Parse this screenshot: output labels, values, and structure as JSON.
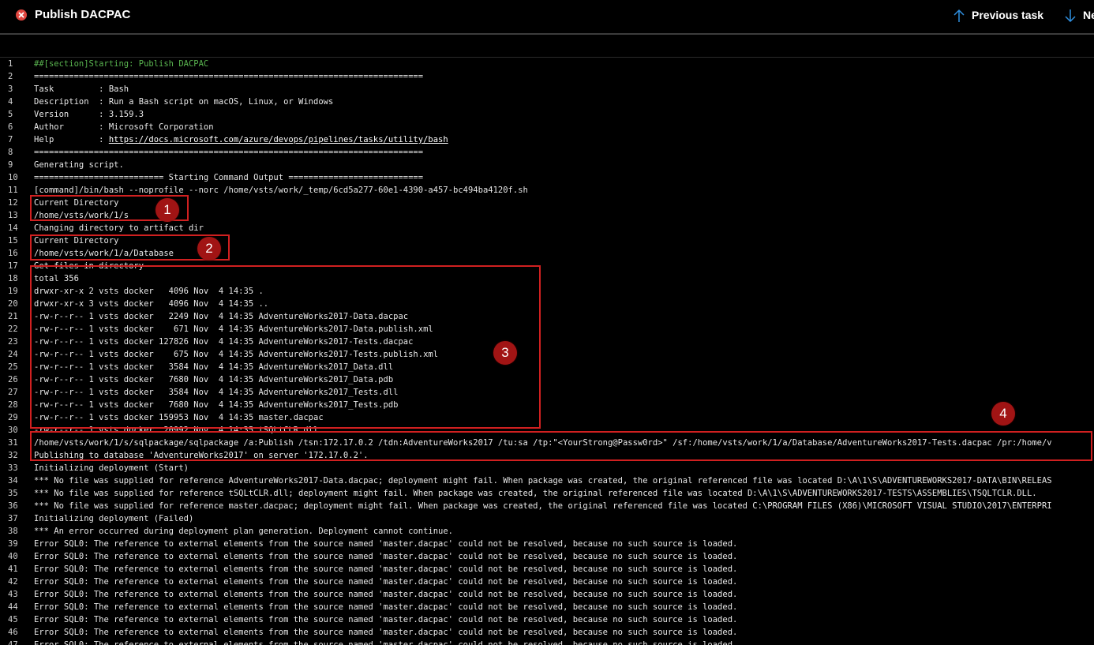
{
  "header": {
    "title": "Publish DACPAC",
    "previous_label": "Previous task",
    "next_label": "Ne"
  },
  "log_lines": [
    {
      "n": "1",
      "t": "##[section]Starting: Publish DACPAC"
    },
    {
      "n": "2",
      "t": "=============================================================================="
    },
    {
      "n": "3",
      "t": "Task         : Bash"
    },
    {
      "n": "4",
      "t": "Description  : Run a Bash script on macOS, Linux, or Windows"
    },
    {
      "n": "5",
      "t": "Version      : 3.159.3"
    },
    {
      "n": "6",
      "t": "Author       : Microsoft Corporation"
    },
    {
      "n": "7",
      "t": "Help         : https://docs.microsoft.com/azure/devops/pipelines/tasks/utility/bash"
    },
    {
      "n": "8",
      "t": "=============================================================================="
    },
    {
      "n": "9",
      "t": "Generating script."
    },
    {
      "n": "10",
      "t": "========================== Starting Command Output ==========================="
    },
    {
      "n": "11",
      "t": "[command]/bin/bash --noprofile --norc /home/vsts/work/_temp/6cd5a277-60e1-4390-a457-bc494ba4120f.sh"
    },
    {
      "n": "12",
      "t": "Current Directory"
    },
    {
      "n": "13",
      "t": "/home/vsts/work/1/s"
    },
    {
      "n": "14",
      "t": "Changing directory to artifact dir"
    },
    {
      "n": "15",
      "t": "Current Directory"
    },
    {
      "n": "16",
      "t": "/home/vsts/work/1/a/Database"
    },
    {
      "n": "17",
      "t": "Get files in directory"
    },
    {
      "n": "18",
      "t": "total 356"
    },
    {
      "n": "19",
      "t": "drwxr-xr-x 2 vsts docker   4096 Nov  4 14:35 ."
    },
    {
      "n": "20",
      "t": "drwxr-xr-x 3 vsts docker   4096 Nov  4 14:35 .."
    },
    {
      "n": "21",
      "t": "-rw-r--r-- 1 vsts docker   2249 Nov  4 14:35 AdventureWorks2017-Data.dacpac"
    },
    {
      "n": "22",
      "t": "-rw-r--r-- 1 vsts docker    671 Nov  4 14:35 AdventureWorks2017-Data.publish.xml"
    },
    {
      "n": "23",
      "t": "-rw-r--r-- 1 vsts docker 127826 Nov  4 14:35 AdventureWorks2017-Tests.dacpac"
    },
    {
      "n": "24",
      "t": "-rw-r--r-- 1 vsts docker    675 Nov  4 14:35 AdventureWorks2017-Tests.publish.xml"
    },
    {
      "n": "25",
      "t": "-rw-r--r-- 1 vsts docker   3584 Nov  4 14:35 AdventureWorks2017_Data.dll"
    },
    {
      "n": "26",
      "t": "-rw-r--r-- 1 vsts docker   7680 Nov  4 14:35 AdventureWorks2017_Data.pdb"
    },
    {
      "n": "27",
      "t": "-rw-r--r-- 1 vsts docker   3584 Nov  4 14:35 AdventureWorks2017_Tests.dll"
    },
    {
      "n": "28",
      "t": "-rw-r--r-- 1 vsts docker   7680 Nov  4 14:35 AdventureWorks2017_Tests.pdb"
    },
    {
      "n": "29",
      "t": "-rw-r--r-- 1 vsts docker 159953 Nov  4 14:35 master.dacpac"
    },
    {
      "n": "30",
      "t": "-rw-r--r-- 1 vsts docker  20992 Nov  4 14:35 tSQLtCLR.dll"
    },
    {
      "n": "31",
      "t": "/home/vsts/work/1/s/sqlpackage/sqlpackage /a:Publish /tsn:172.17.0.2 /tdn:AdventureWorks2017 /tu:sa /tp:\"<YourStrong@Passw0rd>\" /sf:/home/vsts/work/1/a/Database/AdventureWorks2017-Tests.dacpac /pr:/home/v"
    },
    {
      "n": "32",
      "t": "Publishing to database 'AdventureWorks2017' on server '172.17.0.2'."
    },
    {
      "n": "33",
      "t": "Initializing deployment (Start)"
    },
    {
      "n": "34",
      "t": "*** No file was supplied for reference AdventureWorks2017-Data.dacpac; deployment might fail. When package was created, the original referenced file was located D:\\A\\1\\S\\ADVENTUREWORKS2017-DATA\\BIN\\RELEAS"
    },
    {
      "n": "35",
      "t": "*** No file was supplied for reference tSQLtCLR.dll; deployment might fail. When package was created, the original referenced file was located D:\\A\\1\\S\\ADVENTUREWORKS2017-TESTS\\ASSEMBLIES\\TSQLTCLR.DLL."
    },
    {
      "n": "36",
      "t": "*** No file was supplied for reference master.dacpac; deployment might fail. When package was created, the original referenced file was located C:\\PROGRAM FILES (X86)\\MICROSOFT VISUAL STUDIO\\2017\\ENTERPRI"
    },
    {
      "n": "37",
      "t": "Initializing deployment (Failed)"
    },
    {
      "n": "38",
      "t": "*** An error occurred during deployment plan generation. Deployment cannot continue."
    },
    {
      "n": "39",
      "t": "Error SQL0: The reference to external elements from the source named 'master.dacpac' could not be resolved, because no such source is loaded."
    },
    {
      "n": "40",
      "t": "Error SQL0: The reference to external elements from the source named 'master.dacpac' could not be resolved, because no such source is loaded."
    },
    {
      "n": "41",
      "t": "Error SQL0: The reference to external elements from the source named 'master.dacpac' could not be resolved, because no such source is loaded."
    },
    {
      "n": "42",
      "t": "Error SQL0: The reference to external elements from the source named 'master.dacpac' could not be resolved, because no such source is loaded."
    },
    {
      "n": "43",
      "t": "Error SQL0: The reference to external elements from the source named 'master.dacpac' could not be resolved, because no such source is loaded."
    },
    {
      "n": "44",
      "t": "Error SQL0: The reference to external elements from the source named 'master.dacpac' could not be resolved, because no such source is loaded."
    },
    {
      "n": "45",
      "t": "Error SQL0: The reference to external elements from the source named 'master.dacpac' could not be resolved, because no such source is loaded."
    },
    {
      "n": "46",
      "t": "Error SQL0: The reference to external elements from the source named 'master.dacpac' could not be resolved, because no such source is loaded."
    },
    {
      "n": "47",
      "t": "Error SQL0: The reference to external elements from the source named 'master.dacpac' could not be resolved, because no such source is loaded."
    }
  ],
  "markers": [
    "1",
    "2",
    "3",
    "4"
  ],
  "colors": {
    "accent": "#0078d4",
    "section": "#59b44f",
    "error_icon": "#e0463f",
    "highlight": "#d02020"
  }
}
